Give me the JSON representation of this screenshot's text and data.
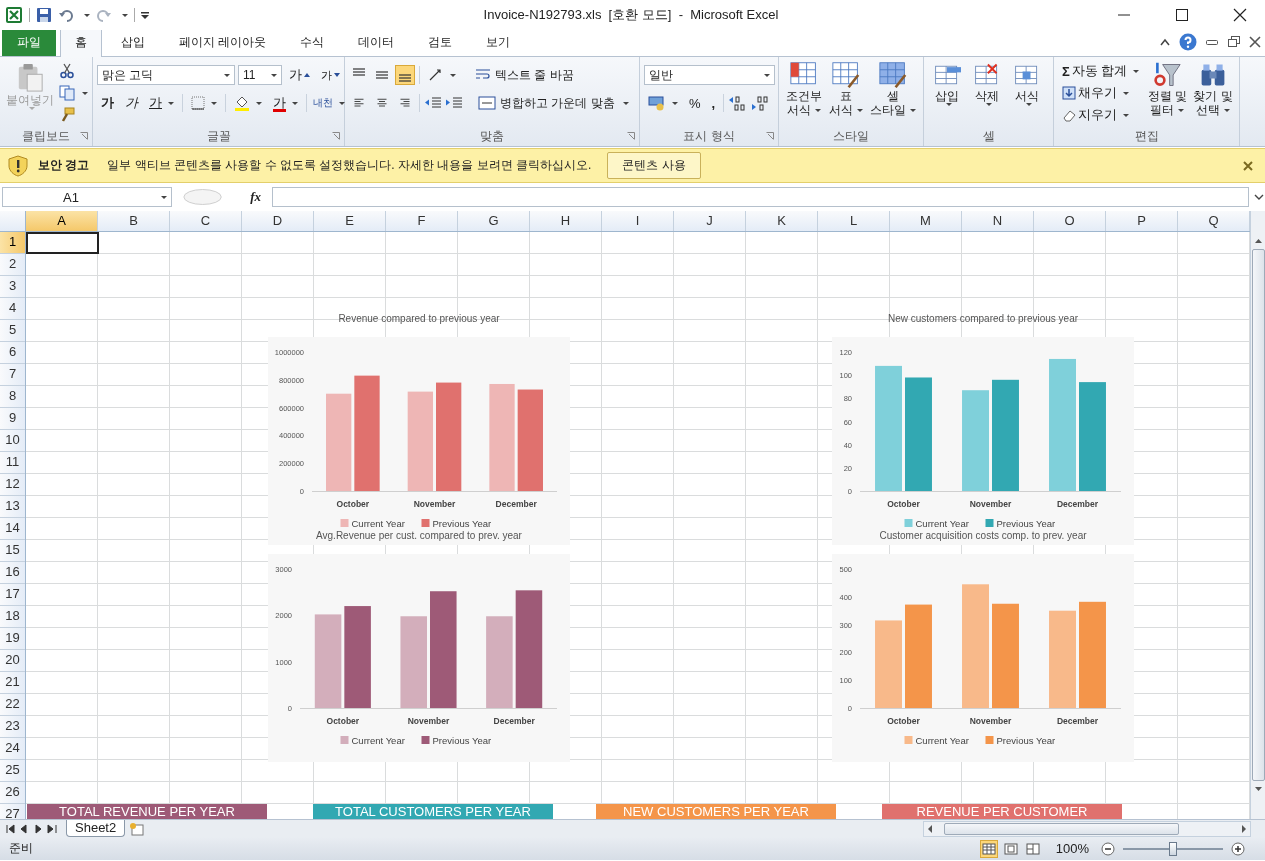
{
  "window": {
    "title": "Invoice-N192793.xls  [호환 모드]  -  Microsoft Excel"
  },
  "ribbon_tabs": [
    {
      "label": "파일",
      "kind": "file",
      "selected": false
    },
    {
      "label": "홈",
      "kind": "tab",
      "selected": true
    },
    {
      "label": "삽입",
      "kind": "tab",
      "selected": false
    },
    {
      "label": "페이지 레이아웃",
      "kind": "tab",
      "selected": false
    },
    {
      "label": "수식",
      "kind": "tab",
      "selected": false
    },
    {
      "label": "데이터",
      "kind": "tab",
      "selected": false
    },
    {
      "label": "검토",
      "kind": "tab",
      "selected": false
    },
    {
      "label": "보기",
      "kind": "tab",
      "selected": false
    }
  ],
  "clipboard": {
    "group": "클립보드",
    "paste": "붙여넣기",
    "paste_disabled": true
  },
  "font": {
    "group": "글꼴",
    "name": "맑은 고딕",
    "size": "11",
    "grow": "가",
    "shrink": "가",
    "bold": "가",
    "italic": "가",
    "underline": "가",
    "font_color": "가",
    "phonetic": "내천"
  },
  "alignment": {
    "group": "맞춤",
    "vertical": [
      {
        "kind": "top",
        "selected": false
      },
      {
        "kind": "middle",
        "selected": false
      },
      {
        "kind": "bottom",
        "selected": true
      }
    ],
    "horizontal": [
      {
        "kind": "left",
        "selected": false
      },
      {
        "kind": "center",
        "selected": false
      },
      {
        "kind": "right",
        "selected": false
      }
    ],
    "wrap": "텍스트 줄 바꿈",
    "merge": "병합하고 가운데 맞춤"
  },
  "number": {
    "group": "표시 형식",
    "format": "일반",
    "percent": "%",
    "comma": ","
  },
  "styles": {
    "group": "스타일",
    "buttons": [
      {
        "label": "조건부\n서식",
        "kind": "conditional"
      },
      {
        "label": "표\n서식",
        "kind": "table"
      },
      {
        "label": "셀\n스타일",
        "kind": "cell"
      }
    ]
  },
  "cells": {
    "group": "셀",
    "buttons": [
      {
        "label": "삽입",
        "kind": "insert"
      },
      {
        "label": "삭제",
        "kind": "delete"
      },
      {
        "label": "서식",
        "kind": "format"
      }
    ]
  },
  "editing": {
    "group": "편집",
    "autosum_symbol": "Σ",
    "autosum": "자동 합계",
    "fill": "채우기",
    "clear": "지우기",
    "sort": "정렬 및\n필터",
    "find": "찾기 및\n선택"
  },
  "security_bar": {
    "title": "보안 경고",
    "message": "일부 액티브 콘텐츠를 사용할 수 없도록 설정했습니다. 자세한 내용을 보려면 클릭하십시오.",
    "button": "콘텐츠 사용"
  },
  "formula_bar": {
    "name_box": "A1",
    "function_label": "fx"
  },
  "sheet": {
    "columns": [
      {
        "label": "A",
        "selected": true
      },
      {
        "label": "B",
        "selected": false
      },
      {
        "label": "C",
        "selected": false
      },
      {
        "label": "D",
        "selected": false
      },
      {
        "label": "E",
        "selected": false
      },
      {
        "label": "F",
        "selected": false
      },
      {
        "label": "G",
        "selected": false
      },
      {
        "label": "H",
        "selected": false
      },
      {
        "label": "I",
        "selected": false
      },
      {
        "label": "J",
        "selected": false
      },
      {
        "label": "K",
        "selected": false
      },
      {
        "label": "L",
        "selected": false
      },
      {
        "label": "M",
        "selected": false
      },
      {
        "label": "N",
        "selected": false
      },
      {
        "label": "O",
        "selected": false
      },
      {
        "label": "P",
        "selected": false
      },
      {
        "label": "Q",
        "selected": false
      }
    ],
    "rows": [
      {
        "label": "1",
        "selected": true
      },
      {
        "label": "2",
        "selected": false
      },
      {
        "label": "3",
        "selected": false
      },
      {
        "label": "4",
        "selected": false
      },
      {
        "label": "5",
        "selected": false
      },
      {
        "label": "6",
        "selected": false
      },
      {
        "label": "7",
        "selected": false
      },
      {
        "label": "8",
        "selected": false
      },
      {
        "label": "9",
        "selected": false
      },
      {
        "label": "10",
        "selected": false
      },
      {
        "label": "11",
        "selected": false
      },
      {
        "label": "12",
        "selected": false
      },
      {
        "label": "13",
        "selected": false
      },
      {
        "label": "14",
        "selected": false
      },
      {
        "label": "15",
        "selected": false
      },
      {
        "label": "16",
        "selected": false
      },
      {
        "label": "17",
        "selected": false
      },
      {
        "label": "18",
        "selected": false
      },
      {
        "label": "19",
        "selected": false
      },
      {
        "label": "20",
        "selected": false
      },
      {
        "label": "21",
        "selected": false
      },
      {
        "label": "22",
        "selected": false
      },
      {
        "label": "23",
        "selected": false
      },
      {
        "label": "24",
        "selected": false
      },
      {
        "label": "25",
        "selected": false
      },
      {
        "label": "26",
        "selected": false
      },
      {
        "label": "27",
        "selected": false
      }
    ],
    "charts": [
      {
        "chart_data": {
          "type": "bar",
          "title": "Revenue compared to previous year",
          "categories": [
            "October",
            "November",
            "December"
          ],
          "series": [
            {
              "name": "Current Year",
              "color": "#eeb6b5",
              "values": [
                700000,
                715000,
                770000
              ]
            },
            {
              "name": "Previous Year",
              "color": "#e0716e",
              "values": [
                830000,
                780000,
                730000
              ]
            }
          ],
          "ylim": [
            0,
            1000000
          ],
          "yticks": [
            0,
            200000,
            400000,
            600000,
            800000,
            1000000
          ],
          "legend": "bottom"
        }
      },
      {
        "chart_data": {
          "type": "bar",
          "title": "New customers compared to previous year",
          "categories": [
            "October",
            "November",
            "December"
          ],
          "series": [
            {
              "name": "Current Year",
              "color": "#7fd0da",
              "values": [
                108,
                87,
                114
              ]
            },
            {
              "name": "Previous Year",
              "color": "#32a8b2",
              "values": [
                98,
                96,
                94
              ]
            }
          ],
          "ylim": [
            0,
            120
          ],
          "yticks": [
            0,
            20,
            40,
            60,
            80,
            100,
            120
          ],
          "legend": "bottom"
        }
      },
      {
        "chart_data": {
          "type": "bar",
          "title": "Avg.Revenue per cust. compared to prev. year",
          "categories": [
            "October",
            "November",
            "December"
          ],
          "series": [
            {
              "name": "Current Year",
              "color": "#d3aebb",
              "values": [
                2020,
                1980,
                1980
              ]
            },
            {
              "name": "Previous Year",
              "color": "#9e5a77",
              "values": [
                2200,
                2520,
                2540
              ]
            }
          ],
          "ylim": [
            0,
            3000
          ],
          "yticks": [
            0,
            1000,
            2000,
            3000
          ],
          "legend": "bottom"
        }
      },
      {
        "chart_data": {
          "type": "bar",
          "title": "Customer acquisition costs comp. to prev. year",
          "categories": [
            "October",
            "November",
            "December"
          ],
          "series": [
            {
              "name": "Current Year",
              "color": "#f8b98a",
              "values": [
                315,
                445,
                350
              ]
            },
            {
              "name": "Previous Year",
              "color": "#f4954a",
              "values": [
                372,
                375,
                382
              ]
            }
          ],
          "ylim": [
            0,
            500
          ],
          "yticks": [
            0,
            100,
            200,
            300,
            400,
            500
          ],
          "legend": "bottom"
        }
      }
    ],
    "banners": [
      {
        "text": "TOTAL REVENUE PER YEAR",
        "color": "#9e5a77"
      },
      {
        "text": "TOTAL CUSTOMERS PER YEAR",
        "color": "#32a8b2"
      },
      {
        "text": "NEW CUSTOMERS PER YEAR",
        "color": "#f4954a"
      },
      {
        "text": "REVENUE PER CUSTOMER",
        "color": "#e0716e"
      }
    ]
  },
  "sheet_tabs": [
    {
      "label": "Sheet2",
      "selected": true
    }
  ],
  "status_bar": {
    "status": "준비",
    "views": [
      {
        "kind": "normal",
        "selected": true
      },
      {
        "kind": "page_layout",
        "selected": false
      },
      {
        "kind": "page_break",
        "selected": false
      }
    ],
    "zoom": "100%",
    "zoom_slider": {
      "level": 0.5
    }
  }
}
